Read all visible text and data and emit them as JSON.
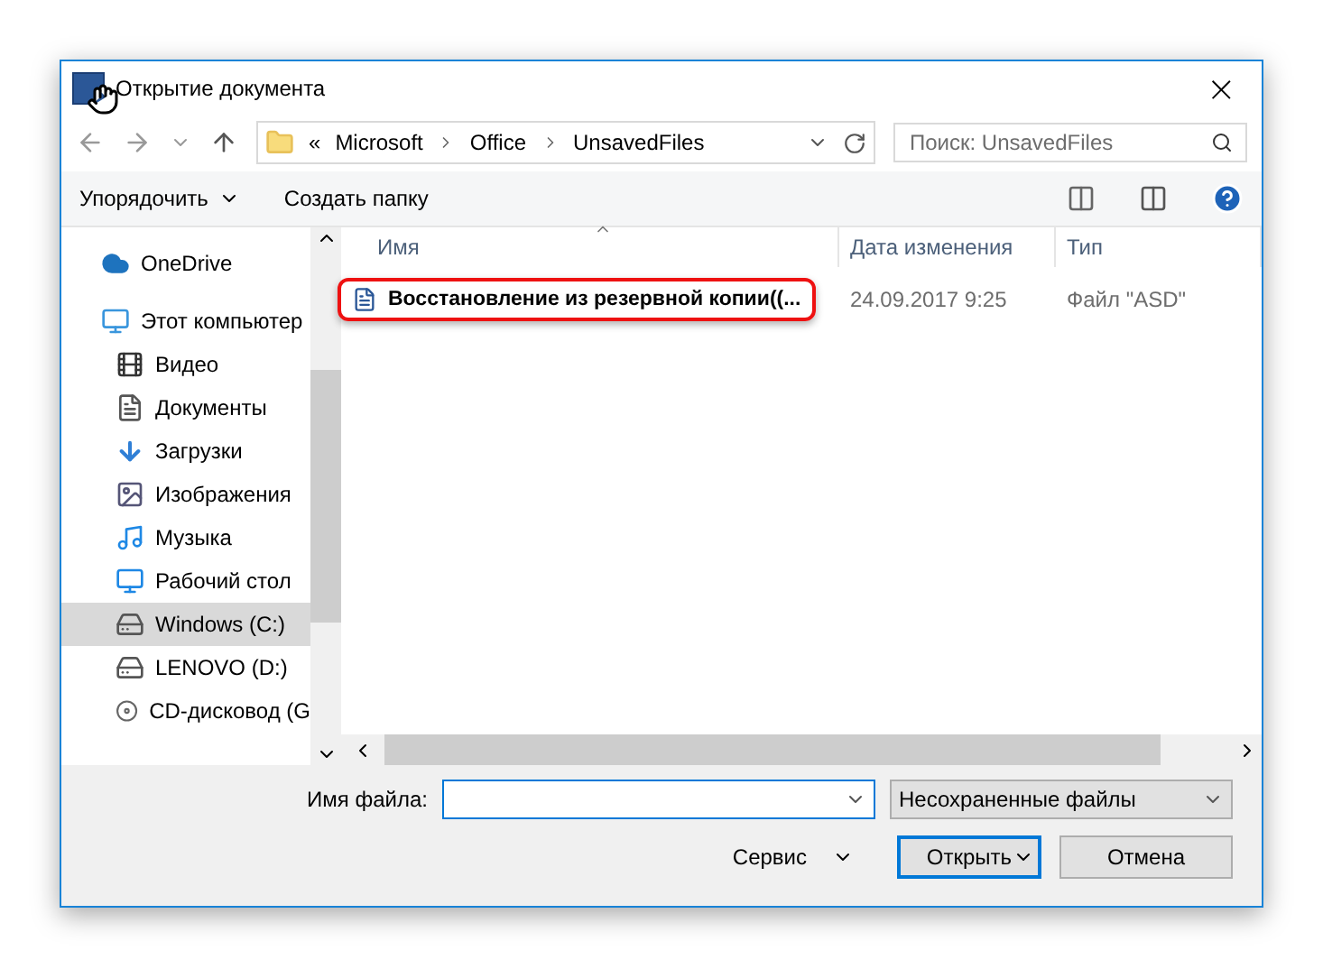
{
  "window": {
    "title": "Открытие документа",
    "close": "×"
  },
  "address": {
    "prefix": "«",
    "path": [
      "Microsoft",
      "Office",
      "UnsavedFiles"
    ]
  },
  "search": {
    "placeholder": "Поиск: UnsavedFiles"
  },
  "toolbar": {
    "organize": "Упорядочить",
    "new_folder": "Создать папку"
  },
  "nav": [
    {
      "label": "OneDrive",
      "kind": "cloud",
      "selected": false
    },
    {
      "label": "Этот компьютер",
      "kind": "pc",
      "selected": false
    },
    {
      "label": "Видео",
      "kind": "video",
      "selected": false
    },
    {
      "label": "Документы",
      "kind": "docs",
      "selected": false
    },
    {
      "label": "Загрузки",
      "kind": "down",
      "selected": false
    },
    {
      "label": "Изображения",
      "kind": "images",
      "selected": false
    },
    {
      "label": "Музыка",
      "kind": "music",
      "selected": false
    },
    {
      "label": "Рабочий стол",
      "kind": "desktop",
      "selected": false
    },
    {
      "label": "Windows (C:)",
      "kind": "drive",
      "selected": true
    },
    {
      "label": "LENOVO (D:)",
      "kind": "drive",
      "selected": false
    },
    {
      "label": "CD-дисковод (G",
      "kind": "cd",
      "selected": false
    }
  ],
  "table": {
    "columns": [
      "Имя",
      "Дата изменения",
      "Тип"
    ],
    "rows": [
      {
        "name": "Восстановление из резервной копии((...",
        "date": "24.09.2017 9:25",
        "type": "Файл \"ASD\"",
        "highlighted": true
      }
    ]
  },
  "footer": {
    "filename_label": "Имя файла:",
    "filter": "Несохраненные файлы",
    "tools": "Сервис",
    "open": "Открыть",
    "cancel": "Отмена"
  }
}
